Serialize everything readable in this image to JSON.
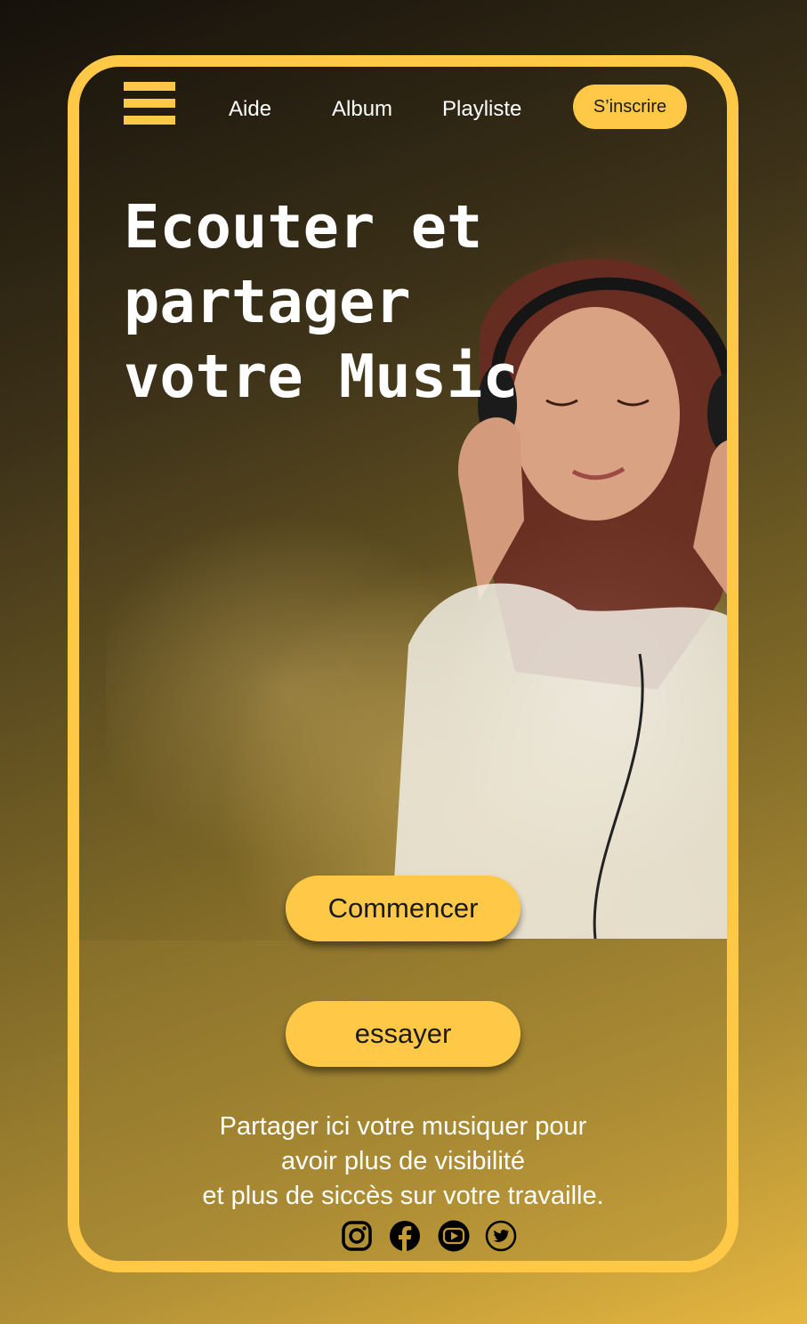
{
  "nav": {
    "links": [
      "Aide",
      "Album",
      "Playliste"
    ],
    "signup_label": "S’inscrire"
  },
  "hero": {
    "title_lines": [
      "Ecouter et",
      "partager",
      "votre Music"
    ]
  },
  "actions": {
    "start_label": "Commencer",
    "try_label": "essayer"
  },
  "tagline": {
    "lines": [
      "Partager ici votre musiquer pour",
      "avoir plus de visibilité",
      "et plus de siccès sur votre travaille."
    ]
  },
  "socials": [
    "instagram-icon",
    "facebook-icon",
    "youtube-icon",
    "twitter-icon"
  ],
  "colors": {
    "accent": "#ffc947",
    "text": "#ffffff",
    "button_text": "#1a1a1a"
  }
}
